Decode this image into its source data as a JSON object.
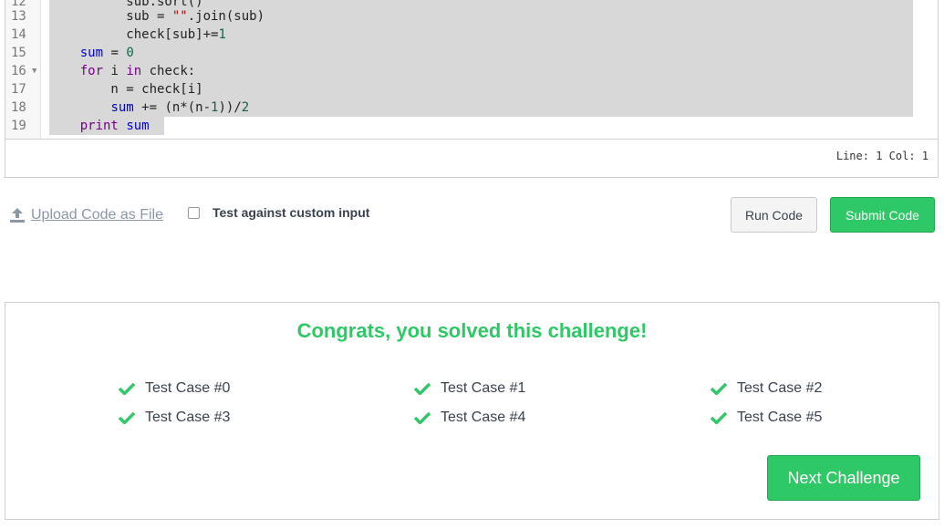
{
  "editor": {
    "lines": [
      {
        "num": "12"
      },
      {
        "num": "13"
      },
      {
        "num": "14"
      },
      {
        "num": "15"
      },
      {
        "num": "16"
      },
      {
        "num": "17"
      },
      {
        "num": "18"
      },
      {
        "num": "19"
      }
    ],
    "status": "Line: 1 Col: 1"
  },
  "toolbar": {
    "upload_label": "Upload Code as File",
    "custom_input_label": "Test against custom input",
    "custom_input_checked": false,
    "run_label": "Run Code",
    "submit_label": "Submit Code"
  },
  "result": {
    "message": "Congrats, you solved this challenge!",
    "test_cases": [
      {
        "label": "Test Case #0",
        "passed": true
      },
      {
        "label": "Test Case #1",
        "passed": true
      },
      {
        "label": "Test Case #2",
        "passed": true
      },
      {
        "label": "Test Case #3",
        "passed": true
      },
      {
        "label": "Test Case #4",
        "passed": true
      },
      {
        "label": "Test Case #5",
        "passed": true
      }
    ],
    "next_label": "Next Challenge"
  },
  "colors": {
    "accent_green": "#2ec866",
    "keyword": "#770088",
    "variable": "#0000cc",
    "number": "#116644",
    "string": "#aa1111"
  }
}
